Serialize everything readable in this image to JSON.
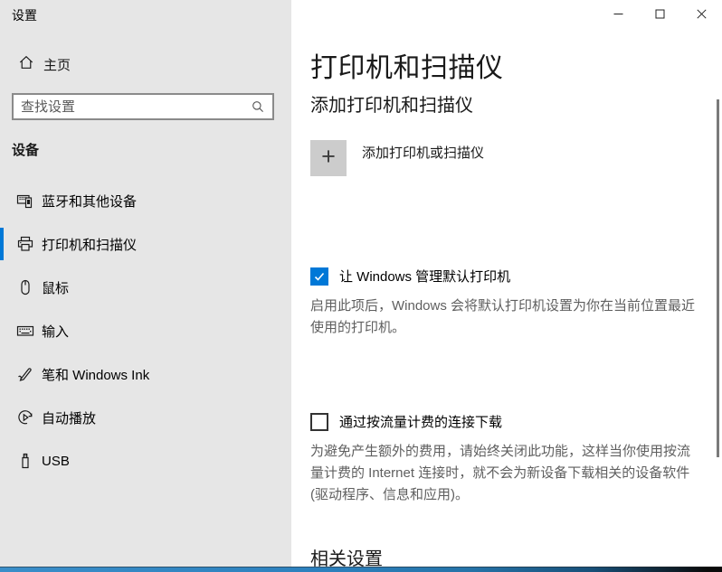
{
  "window": {
    "title": "设置",
    "controls": {
      "minimize": "minimize",
      "maximize": "maximize",
      "close": "close"
    }
  },
  "sidebar": {
    "home_label": "主页",
    "search_placeholder": "查找设置",
    "section_header": "设备",
    "items": [
      {
        "label": "蓝牙和其他设备",
        "icon": "devices-icon",
        "selected": false
      },
      {
        "label": "打印机和扫描仪",
        "icon": "printer-icon",
        "selected": true
      },
      {
        "label": "鼠标",
        "icon": "mouse-icon",
        "selected": false
      },
      {
        "label": "输入",
        "icon": "keyboard-icon",
        "selected": false
      },
      {
        "label": "笔和 Windows Ink",
        "icon": "pen-icon",
        "selected": false
      },
      {
        "label": "自动播放",
        "icon": "autoplay-icon",
        "selected": false
      },
      {
        "label": "USB",
        "icon": "usb-icon",
        "selected": false
      }
    ]
  },
  "main": {
    "title": "打印机和扫描仪",
    "add_section": {
      "heading": "添加打印机和扫描仪",
      "add_button_label": "添加打印机或扫描仪"
    },
    "default_printer": {
      "label": "让 Windows 管理默认打印机",
      "checked": true,
      "description": "启用此项后，Windows 会将默认打印机设置为你在当前位置最近使用的打印机。"
    },
    "metered": {
      "label": "通过按流量计费的连接下载",
      "checked": false,
      "description": "为避免产生额外的费用，请始终关闭此功能，这样当你使用按流量计费的 Internet 连接时，就不会为新设备下载相关的设备软件(驱动程序、信息和应用)。"
    },
    "related_heading": "相关设置"
  },
  "colors": {
    "accent": "#0078d7",
    "sidebar_bg": "#e6e6e6",
    "content_bg": "#ffffff",
    "description_text": "#5f5f5f",
    "add_tile_bg": "#cccccc"
  }
}
